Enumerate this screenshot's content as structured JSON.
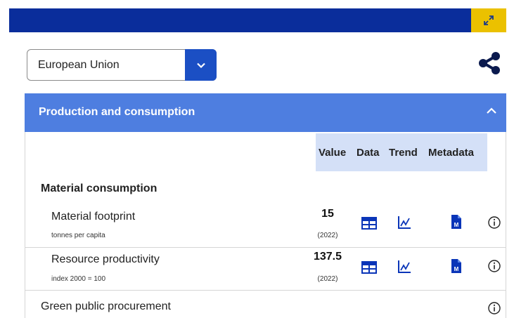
{
  "header": {
    "expand_icon": "expand-icon",
    "accent_color": "#0a2d9b",
    "expand_color": "#ebc100"
  },
  "selector": {
    "selected": "European Union",
    "icon": "chevron-down-icon"
  },
  "share_icon": "share-icon",
  "panel": {
    "title": "Production and consumption",
    "collapse_icon": "chevron-up-icon",
    "columns": [
      "Value",
      "Data",
      "Trend",
      "Metadata"
    ],
    "section_title": "Material consumption",
    "rows": [
      {
        "name": "Material footprint",
        "unit": "tonnes per capita",
        "value": "15",
        "year": "(2022)"
      },
      {
        "name": "Resource productivity",
        "unit": "index 2000 = 100",
        "value": "137.5",
        "year": "(2022)"
      }
    ],
    "next_row": "Green public procurement"
  }
}
